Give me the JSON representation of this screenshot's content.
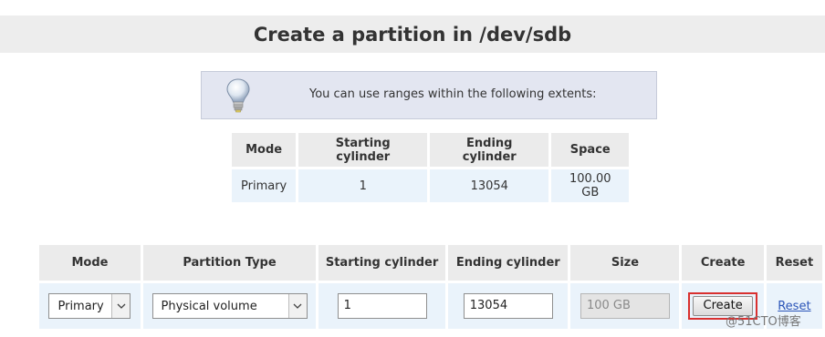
{
  "page": {
    "title": "Create a partition in /dev/sdb"
  },
  "info": {
    "icon": "lightbulb-icon",
    "text": "You can use ranges within the following extents:"
  },
  "extents_table": {
    "headers": [
      "Mode",
      "Starting cylinder",
      "Ending cylinder",
      "Space"
    ],
    "row": [
      "Primary",
      "1",
      "13054",
      "100.00 GB"
    ]
  },
  "create_form": {
    "headers": [
      "Mode",
      "Partition Type",
      "Starting cylinder",
      "Ending cylinder",
      "Size",
      "Create",
      "Reset"
    ],
    "mode_value": "Primary",
    "partition_type_value": "Physical volume",
    "starting_cylinder_value": "1",
    "ending_cylinder_value": "13054",
    "size_value": "100 GB",
    "create_label": "Create",
    "reset_label": "Reset"
  },
  "watermark": "@51CTO博客",
  "colors": {
    "highlight_border": "#d9302f",
    "cell_bg": "#eaf3fb",
    "header_bg": "#ebebeb"
  }
}
